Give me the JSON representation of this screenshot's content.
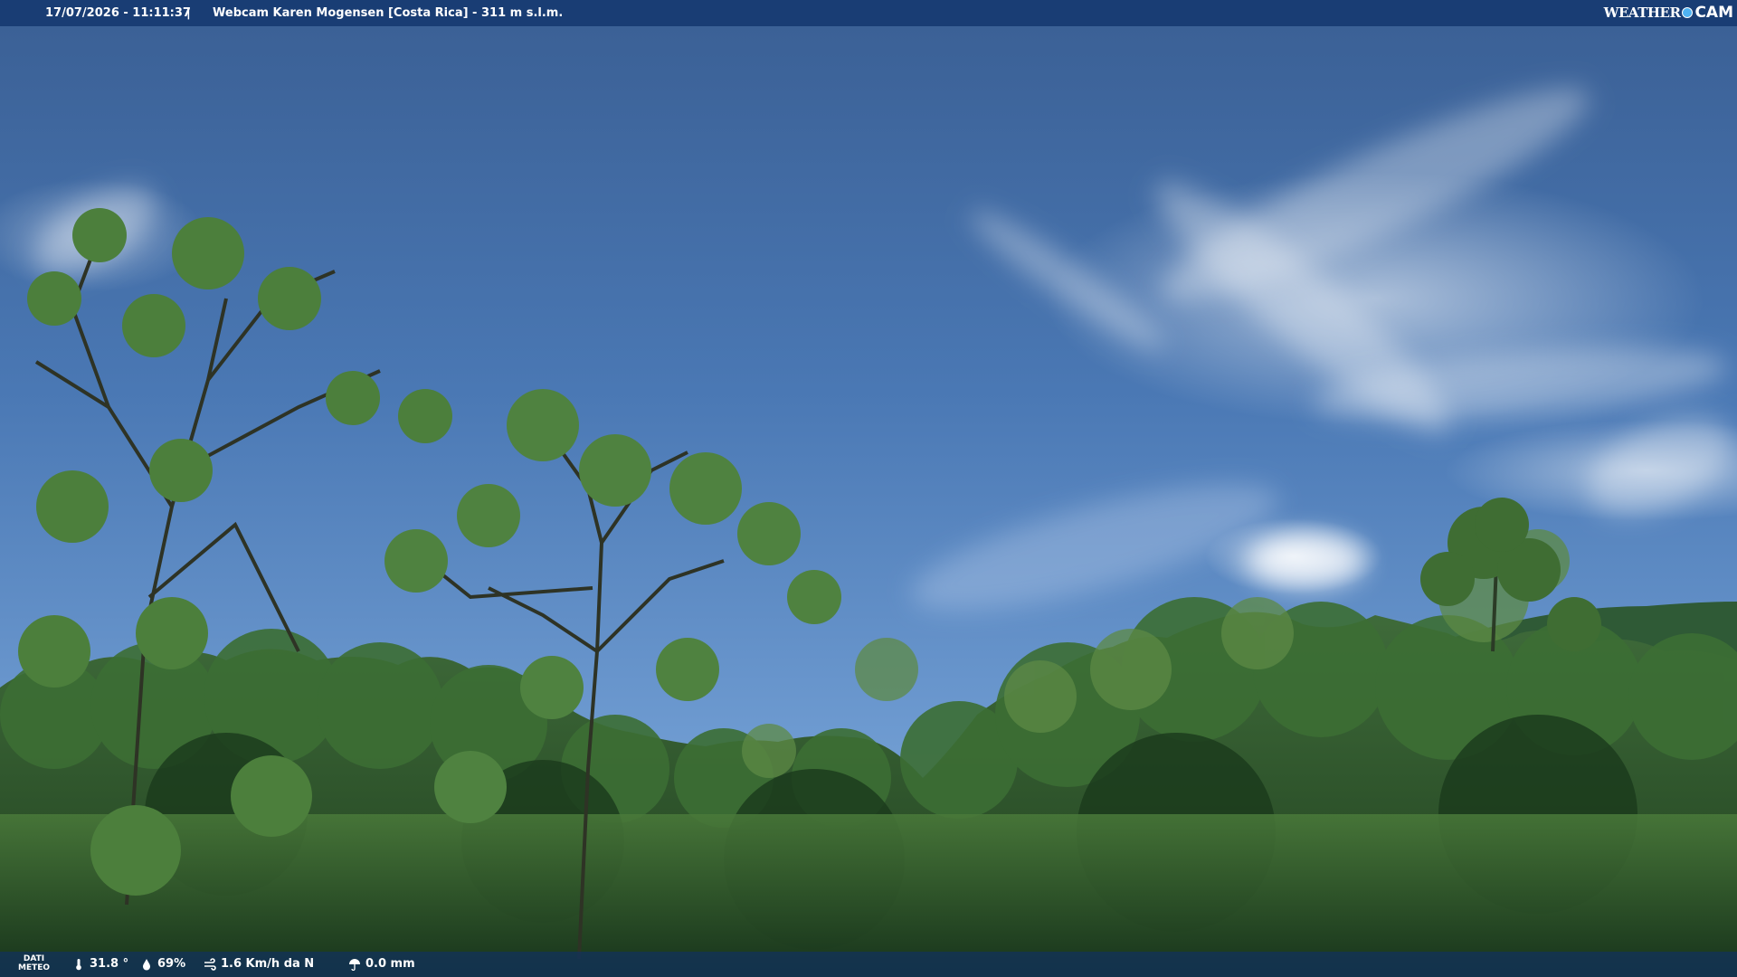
{
  "header": {
    "timestamp": "17/07/2026 - 11:11:37",
    "separator": "|",
    "title": "Webcam Karen Mogensen [Costa Rica] - 311 m s.l.m."
  },
  "brand": {
    "weather": "WEATHER",
    "cam": "CAM"
  },
  "footer": {
    "label_line1": "DATI",
    "label_line2": "METEO",
    "temperature": "31.8 °",
    "humidity": "69%",
    "wind": "1.6 Km/h da N",
    "rain": "0.0 mm"
  },
  "icons": {
    "temperature": "thermometer-icon",
    "humidity": "droplet-icon",
    "wind": "wind-icon",
    "rain": "umbrella-icon"
  },
  "colors": {
    "bar": "#14376e",
    "brand_dot": "#4fb3f2"
  }
}
